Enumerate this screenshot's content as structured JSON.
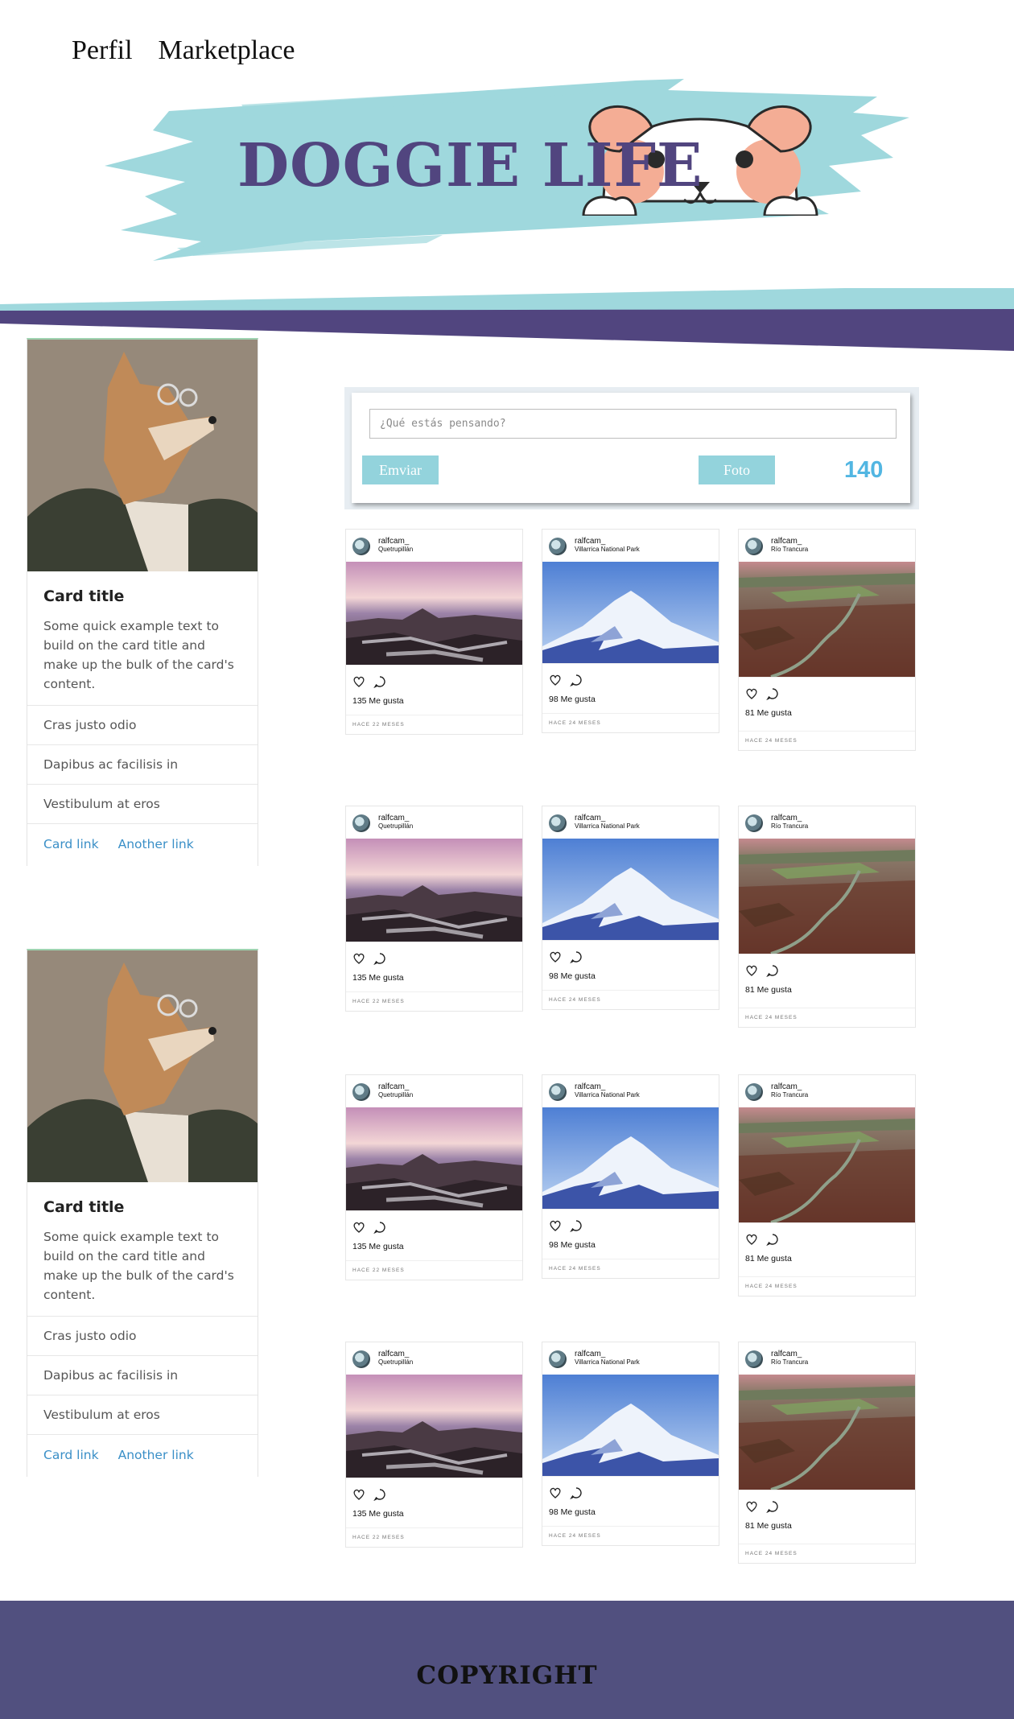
{
  "nav": {
    "profile": "Perfil",
    "marketplace": "Marketplace"
  },
  "banner": {
    "title": "DOGGIE LIFE"
  },
  "colors": {
    "teal": "#93d3dc",
    "purple": "#51457f",
    "footer": "#51507f",
    "link": "#3a8fc7",
    "counter": "#52b6e2"
  },
  "profile_card": {
    "title": "Card title",
    "text": "Some quick example text to build on the card title and make up the bulk of the card's content.",
    "items": [
      "Cras justo odio",
      "Dapibus ac facilisis in",
      "Vestibulum at eros"
    ],
    "link1": "Card link",
    "link2": "Another link"
  },
  "composer": {
    "placeholder": "¿Qué estás pensando?",
    "send": "Emviar",
    "photo": "Foto",
    "counter": "140"
  },
  "posts": [
    {
      "user": "ralfcam_",
      "location": "Quetrupillán",
      "likes": "135 Me gusta",
      "time": "HACE 22 MESES"
    },
    {
      "user": "ralfcam_",
      "location": "Villarrica National Park",
      "likes": "98 Me gusta",
      "time": "HACE 24 MESES"
    },
    {
      "user": "ralfcam_",
      "location": "Río Trancura",
      "likes": "81 Me gusta",
      "time": "HACE 24 MESES"
    }
  ],
  "footer": {
    "text": "COPYRIGHT"
  }
}
